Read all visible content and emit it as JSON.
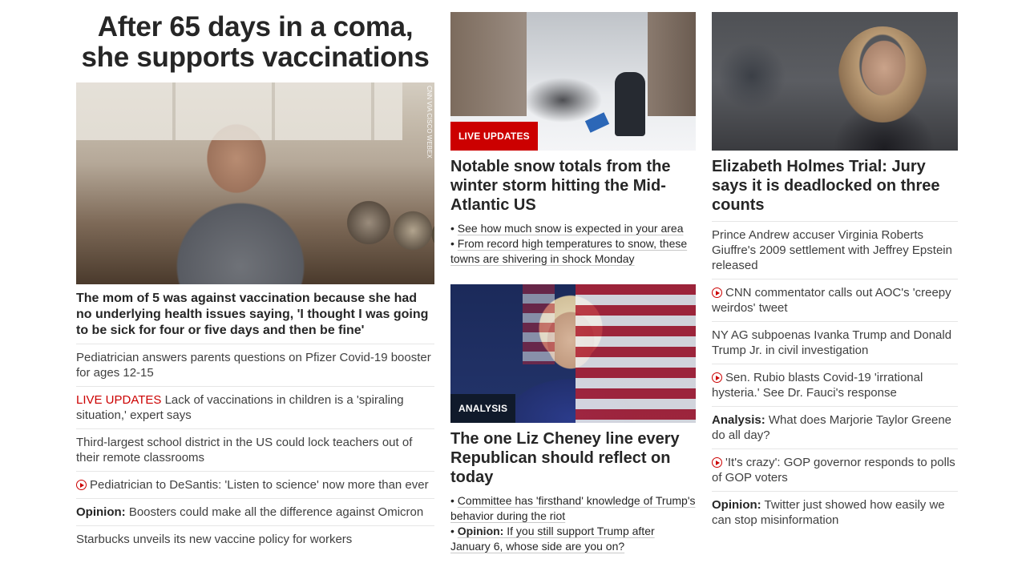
{
  "col1": {
    "headline": "After 65 days in a coma, she supports vaccinations",
    "image_credit": "CNN VIA CISCO WEBEX",
    "lead": "The mom of 5 was against vaccination because she had no underlying health issues saying, 'I thought I was going to be sick for four or five days and then be fine'",
    "items": [
      {
        "text": "Pediatrician answers parents questions on Pfizer Covid-19 booster for ages 12-15"
      },
      {
        "label": "LIVE UPDATES",
        "text": " Lack of vaccinations in children is a 'spiraling situation,' expert says"
      },
      {
        "text": "Third-largest school district in the US could lock teachers out of their remote classrooms"
      },
      {
        "icon": "play-icon",
        "text": "Pediatrician to DeSantis: 'Listen to science' now more than ever"
      },
      {
        "prefix": "Opinion:",
        "text": " Boosters could make all the difference against Omicron"
      },
      {
        "text": "Starbucks unveils its new vaccine policy for workers"
      }
    ]
  },
  "col2": {
    "card1": {
      "badge": "LIVE UPDATES",
      "headline": "Notable snow totals from the winter storm hitting the Mid-Atlantic US",
      "bullets": [
        {
          "text": "See how much snow is expected in your area"
        },
        {
          "text": "From record high temperatures to snow, these towns are shivering in shock Monday"
        }
      ]
    },
    "card2": {
      "badge": "ANALYSIS",
      "headline": "The one Liz Cheney line every Republican should reflect on today",
      "bullets": [
        {
          "text": "Committee has 'firsthand' knowledge of Trump's behavior during the riot"
        },
        {
          "prefix": "Opinion:",
          "text": " If you still support Trump after January 6, whose side are you on?"
        }
      ]
    }
  },
  "col3": {
    "headline": "Elizabeth Holmes Trial: Jury says it is deadlocked on three counts",
    "items": [
      {
        "text": "Prince Andrew accuser Virginia Roberts Giuffre's 2009 settlement with Jeffrey Epstein released"
      },
      {
        "icon": "play-icon",
        "text": "CNN commentator calls out AOC's 'creepy weirdos' tweet"
      },
      {
        "text": "NY AG subpoenas Ivanka Trump and Donald Trump Jr. in civil investigation"
      },
      {
        "icon": "play-icon",
        "text": "Sen. Rubio blasts Covid-19 'irrational hysteria.' See Dr. Fauci's response"
      },
      {
        "prefix": "Analysis:",
        "text": " What does Marjorie Taylor Greene do all day?"
      },
      {
        "icon": "play-icon",
        "text": "'It's crazy': GOP governor responds to polls of GOP voters"
      },
      {
        "prefix": "Opinion:",
        "text": " Twitter just showed how easily we can stop misinformation"
      }
    ]
  },
  "colors": {
    "live_red": "#cc0000",
    "analysis_navy": "#101a2b",
    "text": "#262626"
  }
}
